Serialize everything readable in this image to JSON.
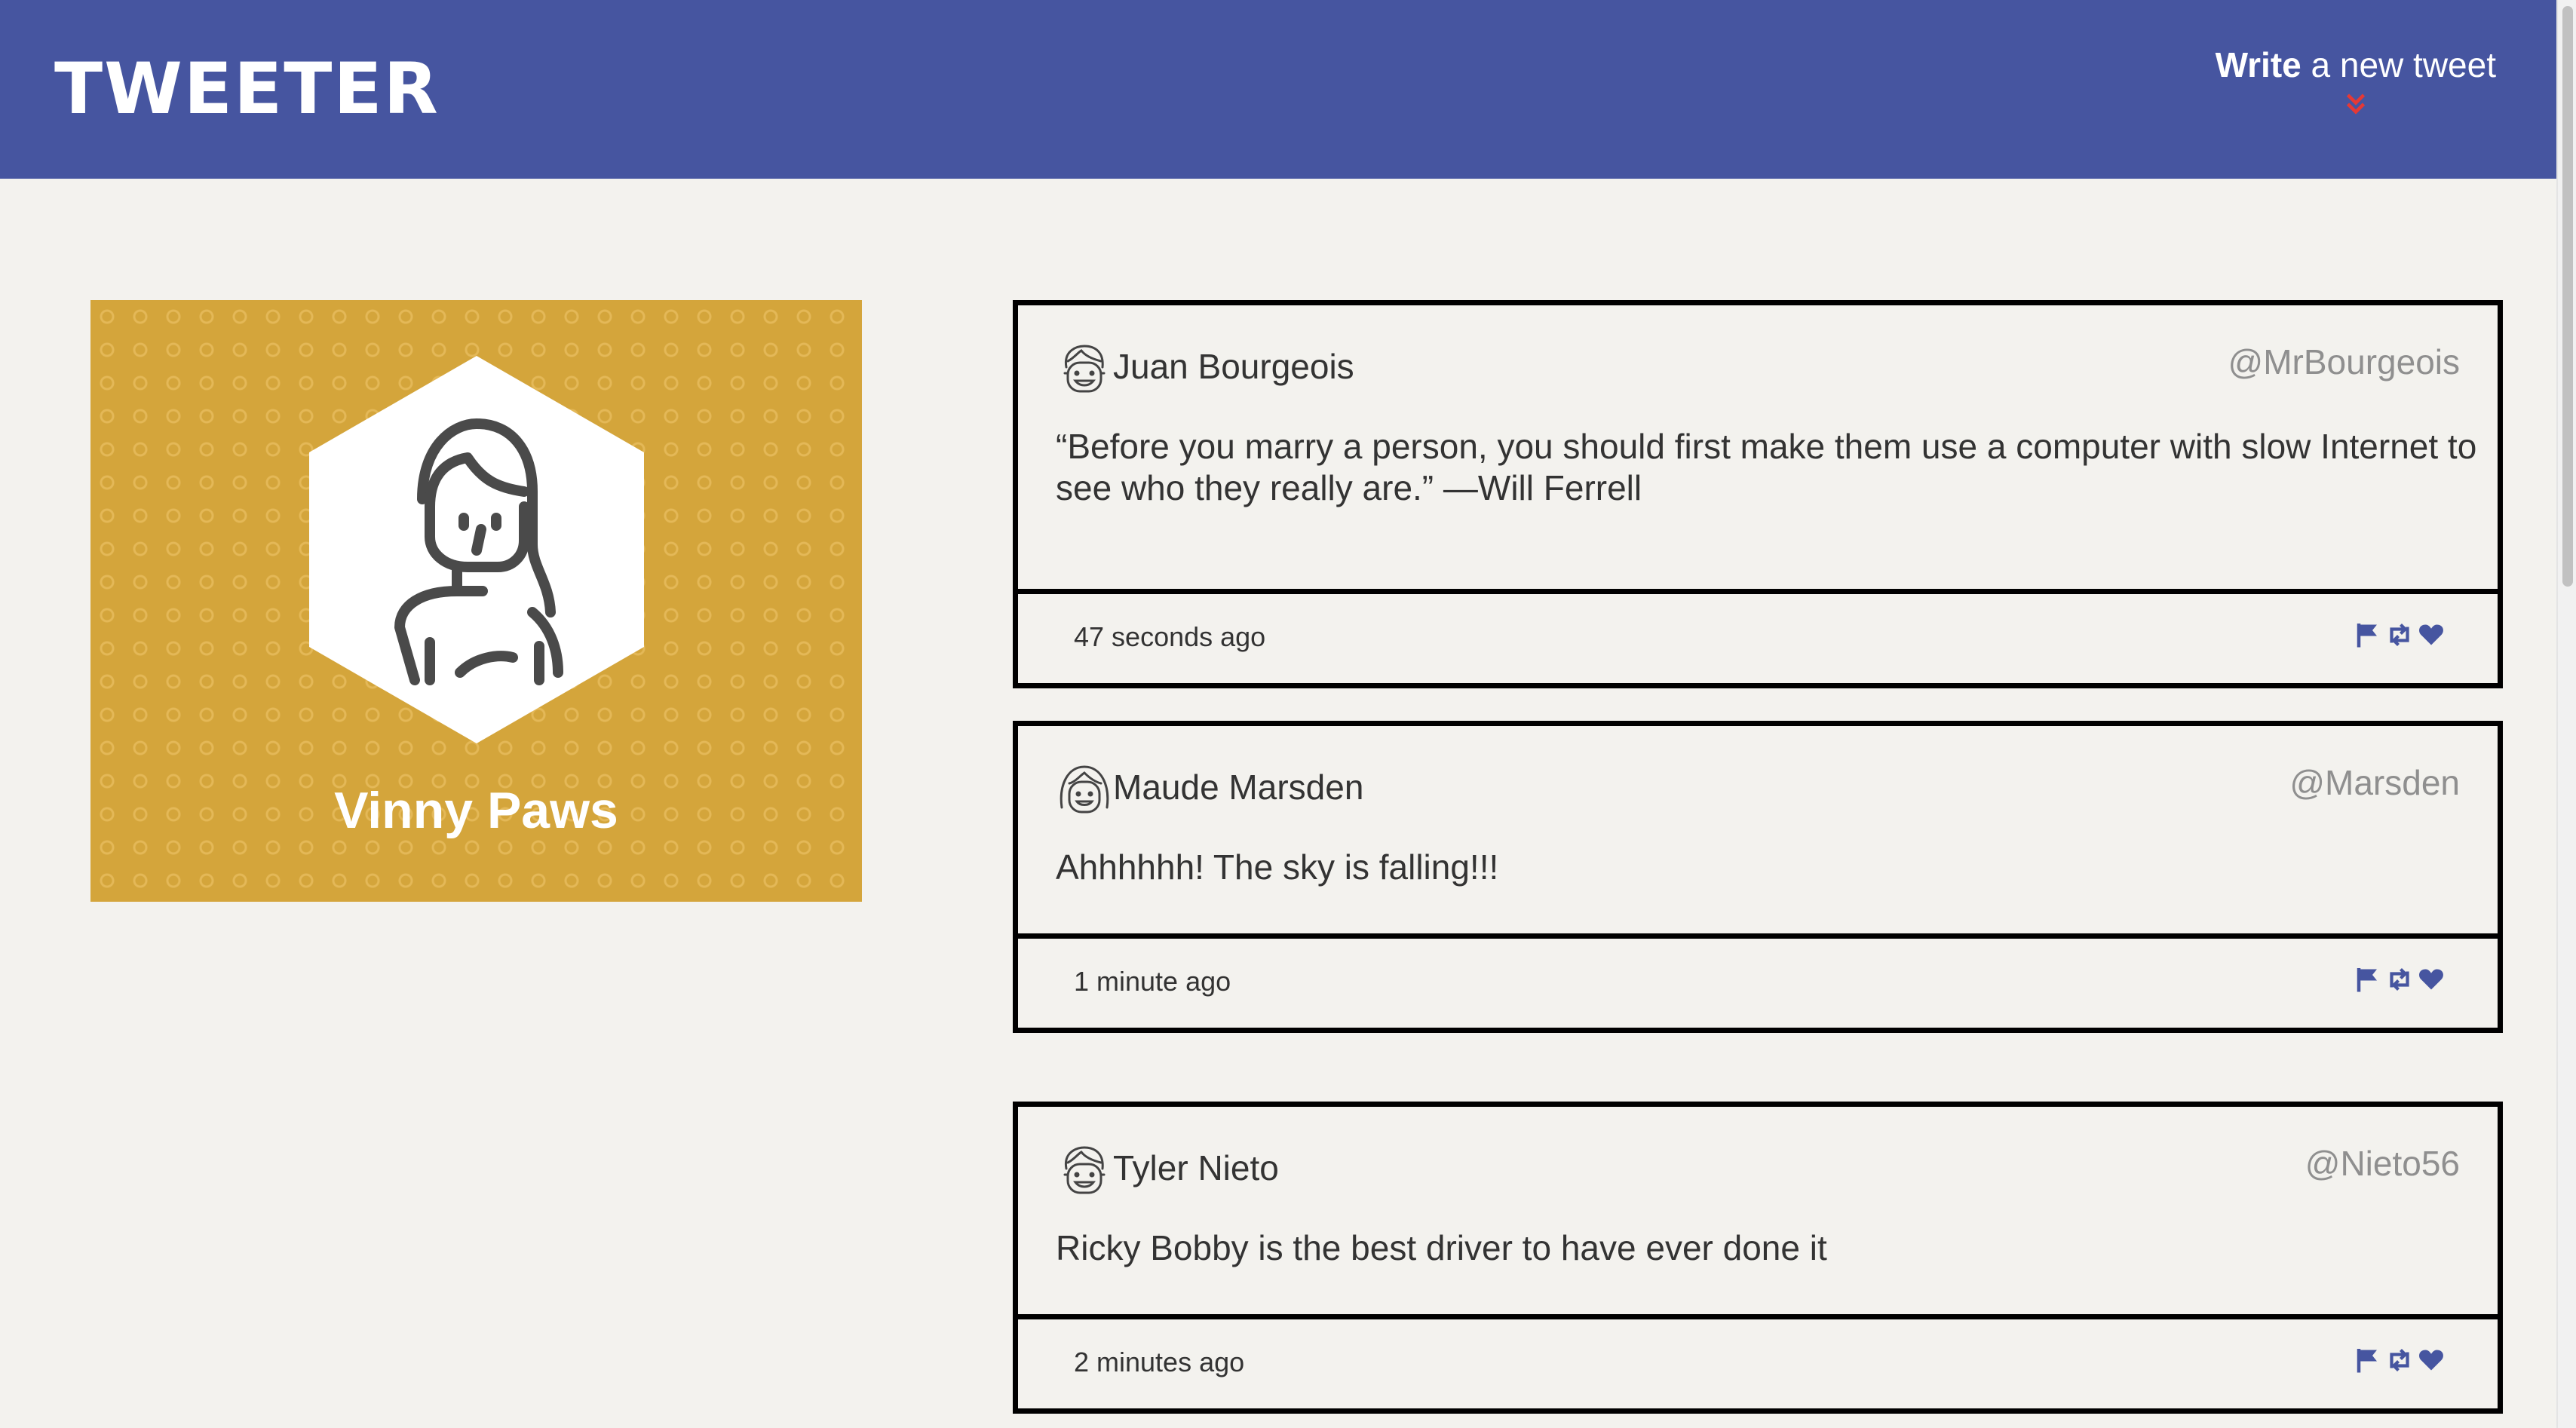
{
  "nav": {
    "brand": "TWEETER",
    "compose_bold": "Write",
    "compose_rest": " a new tweet",
    "accent": "#e53935",
    "background": "#4655a0"
  },
  "profile": {
    "name": "Vinny Paws",
    "background": "#d4a53b"
  },
  "tweets": [
    {
      "name": "Juan Bourgeois",
      "handle": "@MrBourgeois",
      "text": "“Before you marry a person, you should first make them use a computer with slow Internet to see who they really are.” —Will Ferrell",
      "age": "47 seconds ago"
    },
    {
      "name": "Maude Marsden",
      "handle": "@Marsden",
      "text": "Ahhhhhh! The sky is falling!!!",
      "age": "1 minute ago"
    },
    {
      "name": "Tyler Nieto",
      "handle": "@Nieto56",
      "text": "Ricky Bobby is the best driver to have ever done it",
      "age": "2 minutes ago"
    }
  ],
  "icons": {
    "flag": "flag-icon",
    "retweet": "retweet-icon",
    "like": "heart-icon",
    "icon_color": "#4655a0"
  }
}
